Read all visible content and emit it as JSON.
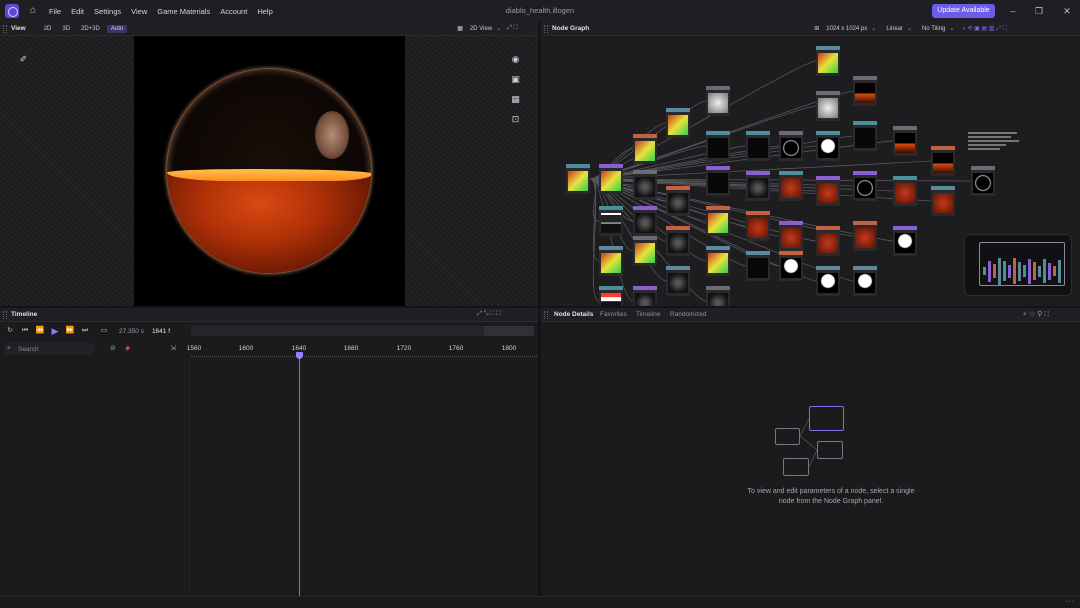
{
  "app": {
    "title": "diablo_health.illogen",
    "menu": [
      "File",
      "Edit",
      "Settings",
      "View",
      "Game Materials",
      "Account",
      "Help"
    ],
    "update_label": "Update Available"
  },
  "view_panel": {
    "title": "View",
    "modes": [
      "2D",
      "3D",
      "2D+3D",
      "Auto"
    ],
    "active_mode": "Auto",
    "view_select": "2D View"
  },
  "node_graph": {
    "title": "Node Graph",
    "resolution": "1024 x 1024 px",
    "filter": "Linear",
    "tiling": "No Tiling"
  },
  "timeline": {
    "title": "Timeline",
    "time": "27.350 s",
    "frame": "1641 f",
    "search_placeholder": "Search",
    "ticks": [
      "1560",
      "1600",
      "1640",
      "1680",
      "1720",
      "1760",
      "1800"
    ]
  },
  "details": {
    "tabs": [
      "Node Details",
      "Favorites",
      "Timeline",
      "Randomized"
    ],
    "hint_line1": "To view and edit parameters of a node, select a single",
    "hint_line2": "node from the Node Graph panel."
  },
  "colors": {
    "accent": "#6c5ce7",
    "node_header": "#4a8f9a"
  }
}
